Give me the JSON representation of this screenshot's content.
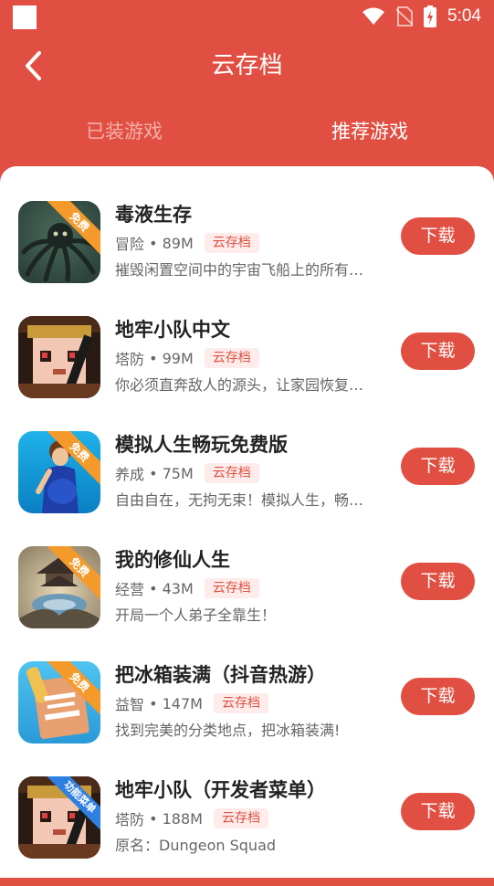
{
  "status": {
    "time": "5:04"
  },
  "header": {
    "title": "云存档"
  },
  "tabs": {
    "installed": "已装游戏",
    "recommended": "推荐游戏"
  },
  "games": [
    {
      "name": "毒液生存",
      "category": "冒险",
      "size": "89M",
      "badge": "云存档",
      "desc": "摧毁闲置空间中的宇宙飞船上的所有敌人",
      "button": "下载",
      "ribbon": "免费",
      "ribbon_color": "#f39a2b"
    },
    {
      "name": "地牢小队中文",
      "category": "塔防",
      "size": "99M",
      "badge": "云存档",
      "desc": "你必须直奔敌人的源头，让家园恢复平静",
      "button": "下载",
      "ribbon": "",
      "ribbon_color": ""
    },
    {
      "name": "模拟人生畅玩免费版",
      "category": "养成",
      "size": "75M",
      "badge": "云存档",
      "desc": "自由自在，无拘无束！模拟人生，畅玩人生",
      "button": "下载",
      "ribbon": "免费",
      "ribbon_color": "#f39a2b"
    },
    {
      "name": "我的修仙人生",
      "category": "经营",
      "size": "43M",
      "badge": "云存档",
      "desc": "开局一个人弟子全靠生！",
      "button": "下载",
      "ribbon": "免费",
      "ribbon_color": "#f39a2b"
    },
    {
      "name": "把冰箱装满（抖音热游）",
      "category": "益智",
      "size": "147M",
      "badge": "云存档",
      "desc": "找到完美的分类地点，把冰箱装满!",
      "button": "下载",
      "ribbon": "免费",
      "ribbon_color": "#f39a2b"
    },
    {
      "name": "地牢小队（开发者菜单）",
      "category": "塔防",
      "size": "188M",
      "badge": "云存档",
      "desc": "原名：Dungeon Squad",
      "button": "下载",
      "ribbon": "功能菜单",
      "ribbon_color": "#2f7fe0"
    }
  ]
}
